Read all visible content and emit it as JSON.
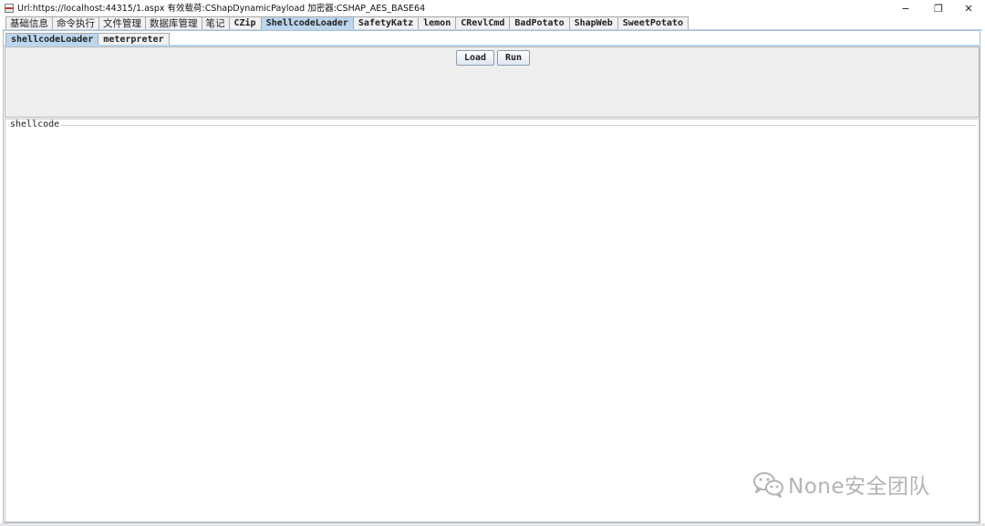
{
  "window": {
    "title": "Url:https://localhost:44315/1.aspx 有效载荷:CShapDynamicPayload 加密器:CSHAP_AES_BASE64",
    "controls": {
      "minimize": "−",
      "maximize": "❐",
      "close": "✕"
    }
  },
  "top_tabs": [
    {
      "label": "基础信息"
    },
    {
      "label": "命令执行"
    },
    {
      "label": "文件管理"
    },
    {
      "label": "数据库管理"
    },
    {
      "label": "笔记"
    },
    {
      "label": "CZip"
    },
    {
      "label": "ShellcodeLoader",
      "selected": true
    },
    {
      "label": "SafetyKatz"
    },
    {
      "label": "lemon"
    },
    {
      "label": "CRevlCmd"
    },
    {
      "label": "BadPotato"
    },
    {
      "label": "ShapWeb"
    },
    {
      "label": "SweetPotato"
    }
  ],
  "sub_tabs": [
    {
      "label": "shellcodeLoader",
      "selected": true
    },
    {
      "label": "meterpreter"
    }
  ],
  "buttons": {
    "load": "Load",
    "run": "Run"
  },
  "shellcode": {
    "legend": "shellcode",
    "value": ""
  },
  "watermark": {
    "text": "None安全团队",
    "icon": "wechat-icon"
  },
  "colors": {
    "selected_tab": "#bcd6ee",
    "panel_bg": "#eeeeee",
    "watermark": "#b4b4b4"
  }
}
